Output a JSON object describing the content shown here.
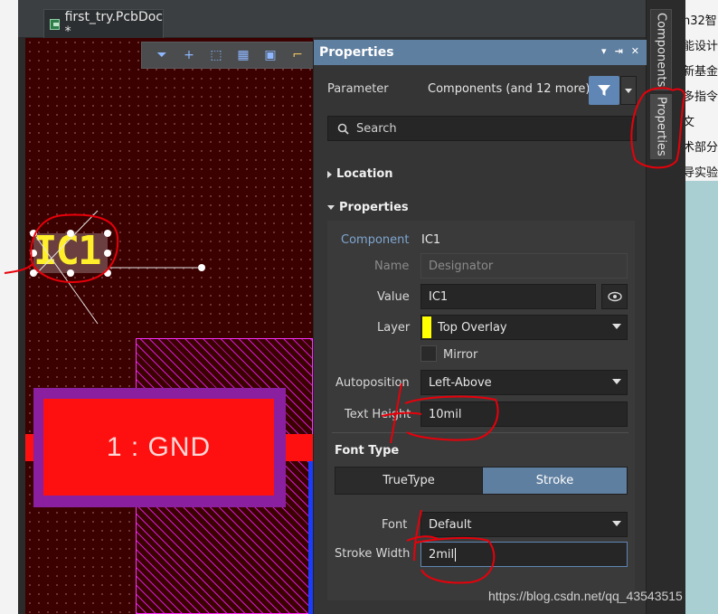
{
  "document": {
    "tab_label": "first_try.PcbDoc *"
  },
  "canvas": {
    "designator_text": "IC1",
    "pad_label": "1 : GND",
    "toolbar": [
      {
        "icon": "filter-icon",
        "glyph": "⏷"
      },
      {
        "icon": "add-icon",
        "glyph": "+"
      },
      {
        "icon": "select-rect-icon",
        "glyph": "⬚"
      },
      {
        "icon": "chart-icon",
        "glyph": "▦"
      },
      {
        "icon": "component-icon",
        "glyph": "▣"
      },
      {
        "icon": "route-icon",
        "glyph": "⌐"
      }
    ]
  },
  "panel": {
    "title": "Properties",
    "header_icons": [
      "▾",
      "⇥",
      "✕"
    ],
    "parameter_label": "Parameter",
    "parameter_value": "Components (and 12 more)",
    "search_placeholder": "Search",
    "location_section": "Location",
    "properties_section": "Properties",
    "component_label": "Component",
    "component_value": "IC1",
    "name_label": "Name",
    "name_placeholder": "Designator",
    "value_label": "Value",
    "value_value": "IC1",
    "layer_label": "Layer",
    "layer_value": "Top Overlay",
    "layer_color": "#ffff00",
    "mirror_label": "Mirror",
    "autoposition_label": "Autoposition",
    "autoposition_value": "Left-Above",
    "text_height_label": "Text Height",
    "text_height_value": "10mil",
    "font_type_section": "Font Type",
    "font_type_options": [
      "TrueType",
      "Stroke"
    ],
    "font_type_selected": "Stroke",
    "font_label": "Font",
    "font_value": "Default",
    "stroke_width_label": "Stroke Width",
    "stroke_width_value": "2mil"
  },
  "side_tabs": {
    "components": "Components",
    "properties": "Properties"
  },
  "background_text": [
    "n32智",
    "能设计",
    "新基金",
    "多指令",
    "文",
    "术部分",
    "导实验"
  ],
  "watermark": "https://blog.csdn.net/qq_43543515",
  "colors": {
    "accent": "#5f7fa0",
    "annotation_red": "#e8000a",
    "pcb_background": "#3b0000"
  }
}
